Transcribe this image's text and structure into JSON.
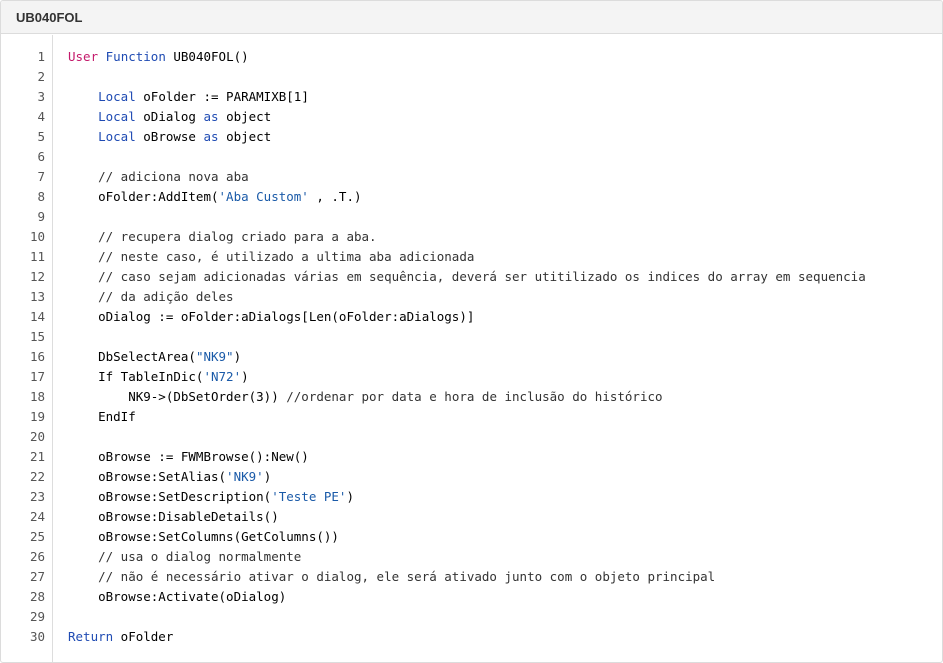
{
  "header": {
    "title": "UB040FOL"
  },
  "colors": {
    "keyword_user_function_first": "#c41a6b",
    "keyword": "#1f4bb3",
    "comment": "#333333",
    "string": "#1a5aa8",
    "text": "#000000",
    "gutter_text": "#555555",
    "header_bg": "#f4f4f4",
    "border": "#dcdcdc"
  },
  "code": {
    "lines": [
      {
        "n": "1",
        "tokens": [
          {
            "t": "kw1",
            "v": "User"
          },
          {
            "t": "txt",
            "v": " "
          },
          {
            "t": "kw2",
            "v": "Function"
          },
          {
            "t": "txt",
            "v": " UB040FOL()"
          }
        ]
      },
      {
        "n": "2",
        "tokens": []
      },
      {
        "n": "3",
        "tokens": [
          {
            "t": "txt",
            "v": "    "
          },
          {
            "t": "kw3",
            "v": "Local"
          },
          {
            "t": "txt",
            "v": " oFolder := PARAMIXB[1]"
          }
        ]
      },
      {
        "n": "4",
        "tokens": [
          {
            "t": "txt",
            "v": "    "
          },
          {
            "t": "kw3",
            "v": "Local"
          },
          {
            "t": "txt",
            "v": " oDialog "
          },
          {
            "t": "kw3",
            "v": "as"
          },
          {
            "t": "txt",
            "v": " object"
          }
        ]
      },
      {
        "n": "5",
        "tokens": [
          {
            "t": "txt",
            "v": "    "
          },
          {
            "t": "kw3",
            "v": "Local"
          },
          {
            "t": "txt",
            "v": " oBrowse "
          },
          {
            "t": "kw3",
            "v": "as"
          },
          {
            "t": "txt",
            "v": " object"
          }
        ]
      },
      {
        "n": "6",
        "tokens": []
      },
      {
        "n": "7",
        "tokens": [
          {
            "t": "com",
            "v": "    // adiciona nova aba"
          }
        ]
      },
      {
        "n": "8",
        "tokens": [
          {
            "t": "txt",
            "v": "    oFolder:AddItem("
          },
          {
            "t": "str",
            "v": "'Aba Custom'"
          },
          {
            "t": "txt",
            "v": " , .T.)"
          }
        ]
      },
      {
        "n": "9",
        "tokens": []
      },
      {
        "n": "10",
        "tokens": [
          {
            "t": "com",
            "v": "    // recupera dialog criado para a aba."
          }
        ]
      },
      {
        "n": "11",
        "tokens": [
          {
            "t": "com",
            "v": "    // neste caso, é utilizado a ultima aba adicionada"
          }
        ]
      },
      {
        "n": "12",
        "tokens": [
          {
            "t": "com",
            "v": "    // caso sejam adicionadas várias em sequência, deverá ser utitilizado os indices do array em sequencia"
          }
        ]
      },
      {
        "n": "13",
        "tokens": [
          {
            "t": "com",
            "v": "    // da adição deles"
          }
        ]
      },
      {
        "n": "14",
        "tokens": [
          {
            "t": "txt",
            "v": "    oDialog := oFolder:aDialogs[Len(oFolder:aDialogs)]"
          }
        ]
      },
      {
        "n": "15",
        "tokens": []
      },
      {
        "n": "16",
        "tokens": [
          {
            "t": "txt",
            "v": "    DbSelectArea("
          },
          {
            "t": "str",
            "v": "\"NK9\""
          },
          {
            "t": "txt",
            "v": ")"
          }
        ]
      },
      {
        "n": "17",
        "tokens": [
          {
            "t": "txt",
            "v": "    If TableInDic("
          },
          {
            "t": "str",
            "v": "'N72'"
          },
          {
            "t": "txt",
            "v": ")"
          }
        ]
      },
      {
        "n": "18",
        "tokens": [
          {
            "t": "txt",
            "v": "        NK9->(DbSetOrder(3)) "
          },
          {
            "t": "com",
            "v": "//ordenar por data e hora de inclusão do histórico"
          }
        ]
      },
      {
        "n": "19",
        "tokens": [
          {
            "t": "txt",
            "v": "    EndIf"
          }
        ]
      },
      {
        "n": "20",
        "tokens": []
      },
      {
        "n": "21",
        "tokens": [
          {
            "t": "txt",
            "v": "    oBrowse := FWMBrowse():New()"
          }
        ]
      },
      {
        "n": "22",
        "tokens": [
          {
            "t": "txt",
            "v": "    oBrowse:SetAlias("
          },
          {
            "t": "str",
            "v": "'NK9'"
          },
          {
            "t": "txt",
            "v": ")"
          }
        ]
      },
      {
        "n": "23",
        "tokens": [
          {
            "t": "txt",
            "v": "    oBrowse:SetDescription("
          },
          {
            "t": "str",
            "v": "'Teste PE'"
          },
          {
            "t": "txt",
            "v": ")"
          }
        ]
      },
      {
        "n": "24",
        "tokens": [
          {
            "t": "txt",
            "v": "    oBrowse:DisableDetails()"
          }
        ]
      },
      {
        "n": "25",
        "tokens": [
          {
            "t": "txt",
            "v": "    oBrowse:SetColumns(GetColumns())"
          }
        ]
      },
      {
        "n": "26",
        "tokens": [
          {
            "t": "com",
            "v": "    // usa o dialog normalmente"
          }
        ]
      },
      {
        "n": "27",
        "tokens": [
          {
            "t": "com",
            "v": "    // não é necessário ativar o dialog, ele será ativado junto com o objeto principal"
          }
        ]
      },
      {
        "n": "28",
        "tokens": [
          {
            "t": "txt",
            "v": "    oBrowse:Activate(oDialog)"
          }
        ]
      },
      {
        "n": "29",
        "tokens": []
      },
      {
        "n": "30",
        "tokens": [
          {
            "t": "kw2",
            "v": "Return"
          },
          {
            "t": "txt",
            "v": " oFolder"
          }
        ]
      }
    ]
  }
}
